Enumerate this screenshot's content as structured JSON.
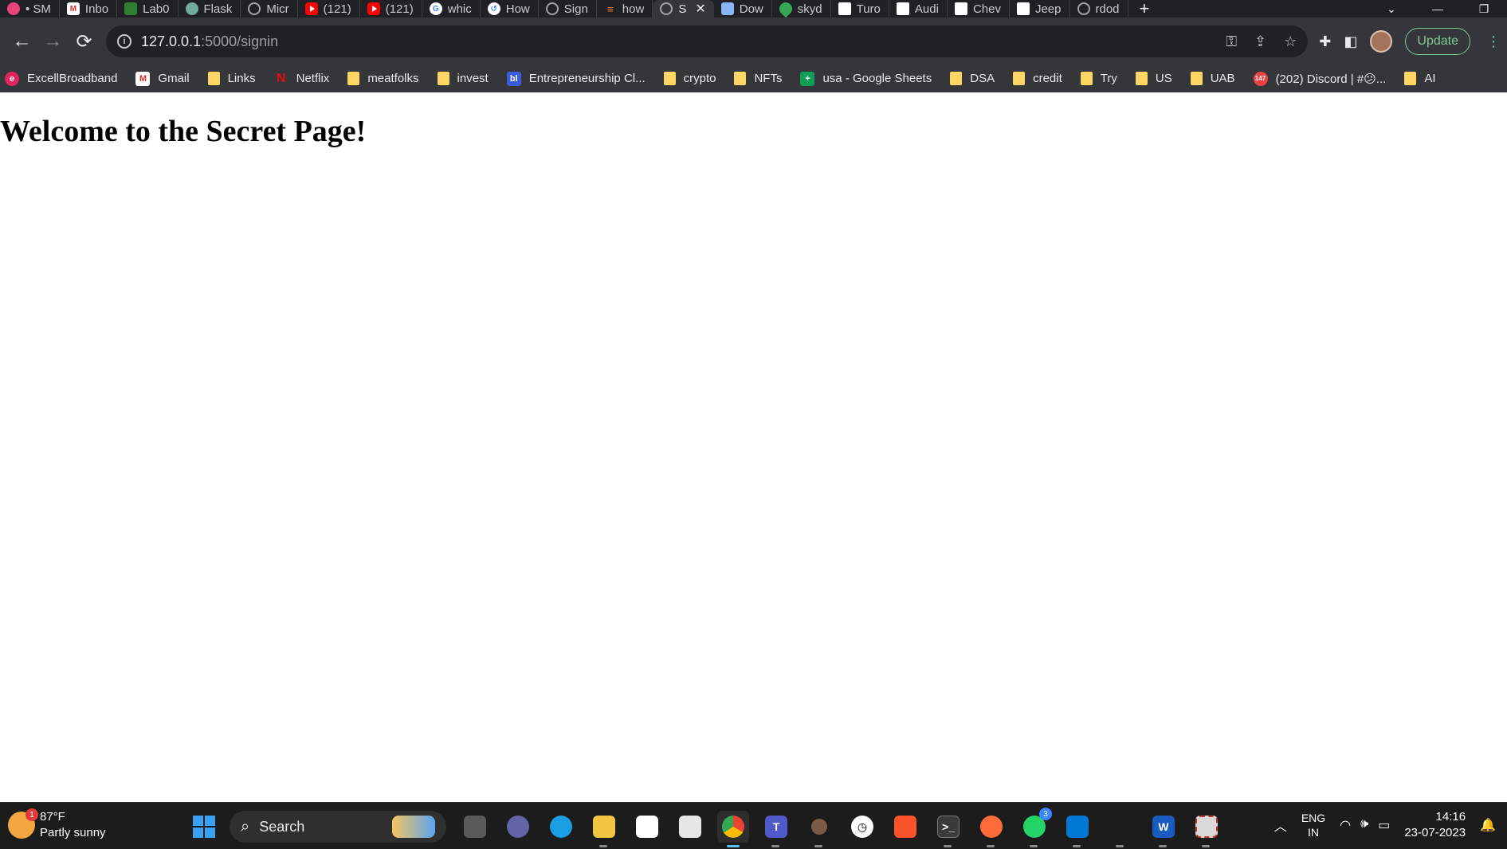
{
  "browser": {
    "tabs": [
      {
        "label": "• SM",
        "icon": "sm-icon"
      },
      {
        "label": "Inbo",
        "icon": "gmail-icon"
      },
      {
        "label": "Lab0",
        "icon": "lab-icon"
      },
      {
        "label": "Flask",
        "icon": "openai-icon"
      },
      {
        "label": "Micr",
        "icon": "globe-icon"
      },
      {
        "label": "(121)",
        "icon": "youtube-icon"
      },
      {
        "label": "(121)",
        "icon": "youtube-icon"
      },
      {
        "label": "whic",
        "icon": "google-icon"
      },
      {
        "label": "How",
        "icon": "how-icon"
      },
      {
        "label": "Sign",
        "icon": "globe-icon"
      },
      {
        "label": "how",
        "icon": "stackoverflow-icon"
      },
      {
        "label": "S",
        "icon": "globe-icon",
        "active": true
      },
      {
        "label": "Dow",
        "icon": "doc-icon"
      },
      {
        "label": "skyd",
        "icon": "maps-icon"
      },
      {
        "label": "Turo",
        "icon": "turo-icon"
      },
      {
        "label": "Audi",
        "icon": "turo-icon"
      },
      {
        "label": "Chev",
        "icon": "turo-icon"
      },
      {
        "label": "Jeep",
        "icon": "turo-icon"
      },
      {
        "label": "rdod",
        "icon": "globe-icon"
      }
    ],
    "new_tab": "+",
    "tab_close": "✕",
    "url_host": "127.0.0.1",
    "url_path": ":5000/signin",
    "update_label": "Update",
    "bookmarks": [
      {
        "label": "ExcellBroadband",
        "icon": "excell-icon"
      },
      {
        "label": "Gmail",
        "icon": "gmail-icon"
      },
      {
        "label": "Links",
        "icon": "folder-icon"
      },
      {
        "label": "Netflix",
        "icon": "netflix-icon"
      },
      {
        "label": "meatfolks",
        "icon": "folder-icon"
      },
      {
        "label": "invest",
        "icon": "folder-icon"
      },
      {
        "label": "Entrepreneurship Cl...",
        "icon": "bl-icon"
      },
      {
        "label": "crypto",
        "icon": "folder-icon"
      },
      {
        "label": "NFTs",
        "icon": "folder-icon"
      },
      {
        "label": "usa - Google Sheets",
        "icon": "sheets-icon"
      },
      {
        "label": "DSA",
        "icon": "folder-icon"
      },
      {
        "label": "credit",
        "icon": "folder-icon"
      },
      {
        "label": "Try",
        "icon": "folder-icon"
      },
      {
        "label": "US",
        "icon": "folder-icon"
      },
      {
        "label": "UAB",
        "icon": "folder-icon"
      },
      {
        "label": "(202) Discord | #😕...",
        "icon": "discord-icon"
      },
      {
        "label": "AI",
        "icon": "folder-icon"
      }
    ]
  },
  "page": {
    "heading": "Welcome to the Secret Page!"
  },
  "taskbar": {
    "weather_temp": "87°F",
    "weather_desc": "Partly sunny",
    "weather_badge": "1",
    "search_label": "Search",
    "whatsapp_badge": "3",
    "lang_1": "ENG",
    "lang_2": "IN",
    "time": "14:16",
    "date": "23-07-2023"
  }
}
